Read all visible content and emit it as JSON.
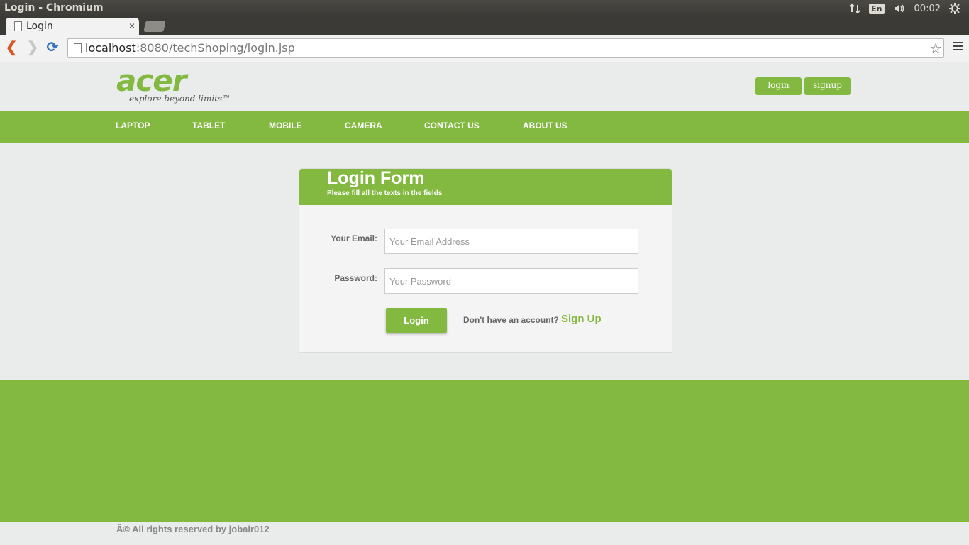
{
  "os": {
    "window_title": "Login - Chromium",
    "language": "En",
    "clock": "00:02"
  },
  "browser": {
    "tab_title": "Login",
    "tab_close": "×",
    "url_host": "localhost",
    "url_rest": ":8080/techShoping/login.jsp"
  },
  "site": {
    "logo_text": "acer",
    "tagline": "explore beyond limits™",
    "header_buttons": {
      "login": "login",
      "signup": "signup"
    },
    "nav": [
      "LAPTOP",
      "TABLET",
      "MOBILE",
      "CAMERA",
      "CONTACT US",
      "ABOUT US"
    ],
    "accent_color": "#83b941"
  },
  "form": {
    "title": "Login Form",
    "subtitle": "Please fill all the texts in the fields",
    "email_label": "Your Email:",
    "email_placeholder": "Your Email Address",
    "password_label": "Password:",
    "password_placeholder": "Your Password",
    "submit_label": "Login",
    "account_prompt": "Don't have an account?",
    "signup_link": "Sign Up"
  },
  "footer": {
    "copyright": "Â© All rights reserved by jobair012"
  }
}
